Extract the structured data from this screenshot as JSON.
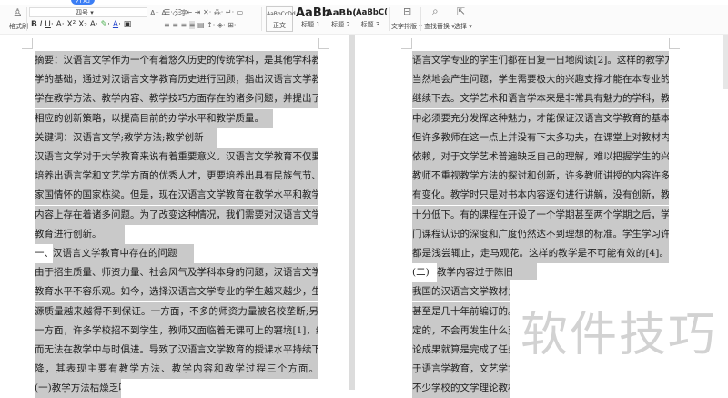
{
  "menubar": {
    "active_tab": "开始"
  },
  "toolbar": {
    "format_painter": "格式刷",
    "font_size": "四号",
    "styles": [
      {
        "preview": "AaBbCcDd",
        "label": "正文"
      },
      {
        "preview": "AaBb",
        "label": "标题 1"
      },
      {
        "preview": "AaBb(",
        "label": "标题 2"
      },
      {
        "preview": "AaBbC(",
        "label": "标题 3"
      }
    ],
    "text_layout": "文字排版 ▾",
    "find_replace": "查找替换 ▾",
    "select": "选择 ▾"
  },
  "left_page": {
    "lines": [
      {
        "text": "摘要：汉语言文学作为一个有着悠久历史的传统学科，是其他学科教",
        "full": true
      },
      {
        "text": "学的基础，通过对汉语言文学教育历史进行回顾，指出汉语言文学教",
        "full": true
      },
      {
        "text": "学在教学方法、教学内容、教学技巧方面存在的诸多问题，并提出了",
        "full": true
      },
      {
        "text": "相应的创新策略，以提高目前的办学水平和教学质量。",
        "full": false
      },
      {
        "text": "关键词：汉语言文学;教学方法;教学创新",
        "full": false
      },
      {
        "text": "汉语言文学对于大学教育来说有着重要意义。汉语言文学教育不仅要",
        "full": true
      },
      {
        "text": "培养出语言学和文艺学方面的优秀人才，更要培养出具有民族气节、",
        "full": true
      },
      {
        "text": "家国情怀的国家栋梁。但是，现在汉语言文学教育在教学水平和教学",
        "full": true
      },
      {
        "text": "内容上存在着诸多问题。为了改变这种情况，我们需要对汉语言文学",
        "full": true
      },
      {
        "text": "教育进行创新。",
        "full": false
      },
      {
        "prefix": "一、",
        "text": "汉语言文学教育中存在的问题",
        "full": false
      },
      {
        "text": "由于招生质量、师资力量、社会风气及学科本身的问题，汉语言文学",
        "full": true
      },
      {
        "text": "教育水平不容乐观。如今，选择汉语言文学专业的学生越来越少，生",
        "full": true
      },
      {
        "text": "源质量越来越得不到保证。一方面，不多的师资力量被名校垄断;另",
        "full": true
      },
      {
        "text": "一方面，许多学校招不到学生，教师又面临着无课可上的窘境[1]，继",
        "full": true
      },
      {
        "text": "而无法在教学中与时俱进。导致了汉语言文学教育的授课水平持续下",
        "full": true
      },
      {
        "text": "降，其表现主要有教学方法、教学内容和教学过程三个方面。",
        "full": true
      },
      {
        "text": "(一)教学方法枯燥乏味",
        "full": false
      }
    ]
  },
  "right_page": {
    "lines": [
      {
        "text": "语言文学专业的学生们都在日复一日地阅读[2]。这样的教学方法理所",
        "full": true
      },
      {
        "text": "当然地会产生问题，学生需要极大的兴趣支撑才能在本专业的学习中",
        "full": true
      },
      {
        "text": "继续下去。文学艺术和语言学本来是非常具有魅力的学科，教学过程",
        "full": true
      },
      {
        "text": "中必须要充分发挥这种魅力，才能保证汉语言文学教育的基本活力。",
        "full": true
      },
      {
        "text": "但许多教师在这一点上并没有下太多功夫，在课堂上对教材内容过于",
        "full": true
      },
      {
        "text": "依赖，对于文学艺术普遍缺乏自己的理解，难以把握学生的兴趣点[3]。",
        "full": true
      },
      {
        "text": "教师不重视教学方法的探讨和创新，许多教师讲授的内容许多年都没",
        "full": true
      },
      {
        "text": "有变化。教学时只是对书本内容逐句进行讲解，没有创新，教学效率",
        "full": true
      },
      {
        "text": "十分低下。有的课程在开设了一个学期甚至两个学期之后，学生对该",
        "full": true
      },
      {
        "text": "门课程认识的深度和广度仍然达不到理想的标准。学生学习许多课程",
        "full": true
      },
      {
        "text": "都是浅尝辄止，走马观花。这样的教学是不可能有效的[4]。",
        "full": true
      },
      {
        "prefix": "(二)",
        "text": "教学内容过于陈旧",
        "full": false
      },
      {
        "text": "我国的汉语言文学教材多年",
        "full": false
      },
      {
        "text": "甚至是几十年前编订的。部",
        "full": false
      },
      {
        "text": "定的，不会再发生什么变化",
        "full": false
      },
      {
        "text": "论成果就算是完成了任务，",
        "full": false
      },
      {
        "text": "于语言学教育，文艺学尤其",
        "full": false
      },
      {
        "text": "不少学校的文学理论教材",
        "full": false
      }
    ]
  },
  "watermark": "软件技巧"
}
